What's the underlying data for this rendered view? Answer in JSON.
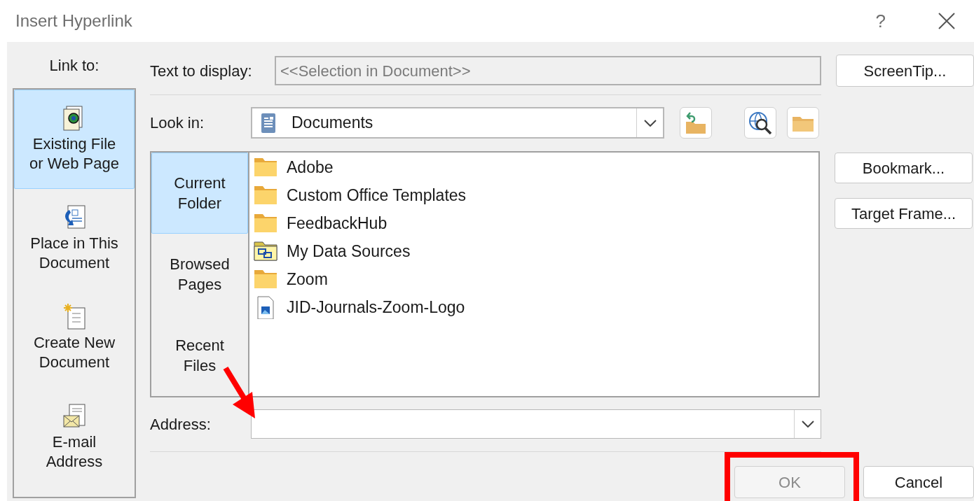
{
  "window": {
    "title": "Insert Hyperlink",
    "help": "?"
  },
  "link_to": {
    "label": "Link to:",
    "items": [
      {
        "label": "Existing File or Web Page",
        "kind": "web-file",
        "selected": true
      },
      {
        "label": "Place in This Document",
        "kind": "place",
        "selected": false
      },
      {
        "label": "Create New Document",
        "kind": "new",
        "selected": false
      },
      {
        "label": "E-mail Address",
        "kind": "email",
        "selected": false
      }
    ]
  },
  "text_to_display": {
    "label": "Text to display:",
    "value": "<<Selection in Document>>",
    "disabled": true
  },
  "screentip_button": "ScreenTip...",
  "look_in": {
    "label": "Look in:",
    "value": "Documents"
  },
  "nav": [
    {
      "label": "Current Folder",
      "selected": true
    },
    {
      "label": "Browsed Pages",
      "selected": false
    },
    {
      "label": "Recent Files",
      "selected": false
    }
  ],
  "files": [
    {
      "name": "Adobe",
      "kind": "folder"
    },
    {
      "name": "Custom Office Templates",
      "kind": "folder"
    },
    {
      "name": "FeedbackHub",
      "kind": "folder"
    },
    {
      "name": "My Data Sources",
      "kind": "data-folder"
    },
    {
      "name": "Zoom",
      "kind": "folder"
    },
    {
      "name": "JID-Journals-Zoom-Logo",
      "kind": "image-file"
    }
  ],
  "side_buttons": [
    "Bookmark...",
    "Target Frame..."
  ],
  "address": {
    "label": "Address:"
  },
  "buttons": [
    {
      "label": "OK",
      "disabled": true
    },
    {
      "label": "Cancel",
      "disabled": false
    }
  ],
  "annotations": {
    "arrow": true,
    "highlight": true
  }
}
